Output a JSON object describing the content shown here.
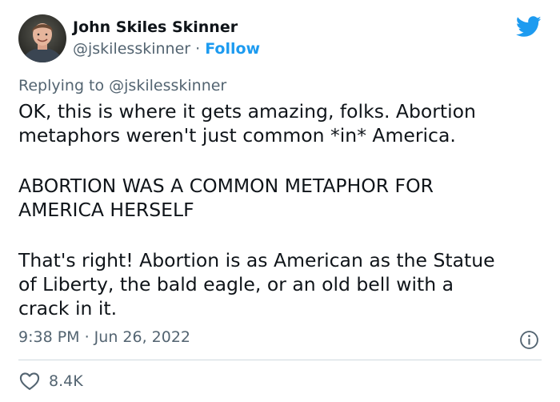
{
  "author": {
    "display_name": "John Skiles Skinner",
    "handle": "@jskilesskinner",
    "separator": " · ",
    "follow_label": "Follow"
  },
  "reply_context": {
    "prefix": "Replying to ",
    "handle": "@jskilesskinner"
  },
  "tweet": {
    "paragraph_1": "OK, this is where it gets amazing, folks. Abortion\nmetaphors weren't just common *in* America.",
    "paragraph_2": "ABORTION WAS A COMMON METAPHOR FOR\nAMERICA HERSELF",
    "paragraph_3": "That's right! Abortion is as American as the Statue\nof Liberty, the bald eagle, or an old bell with a\ncrack in it.",
    "timestamp": "9:38 PM · Jun 26, 2022"
  },
  "engagement": {
    "like_count": "8.4K"
  },
  "colors": {
    "accent": "#1d9bf0",
    "text_primary": "#0f1419",
    "text_secondary": "#536471",
    "divider": "#cfd9de"
  },
  "icons": {
    "brand": "twitter-bird-icon",
    "info": "info-icon",
    "like": "heart-icon"
  }
}
